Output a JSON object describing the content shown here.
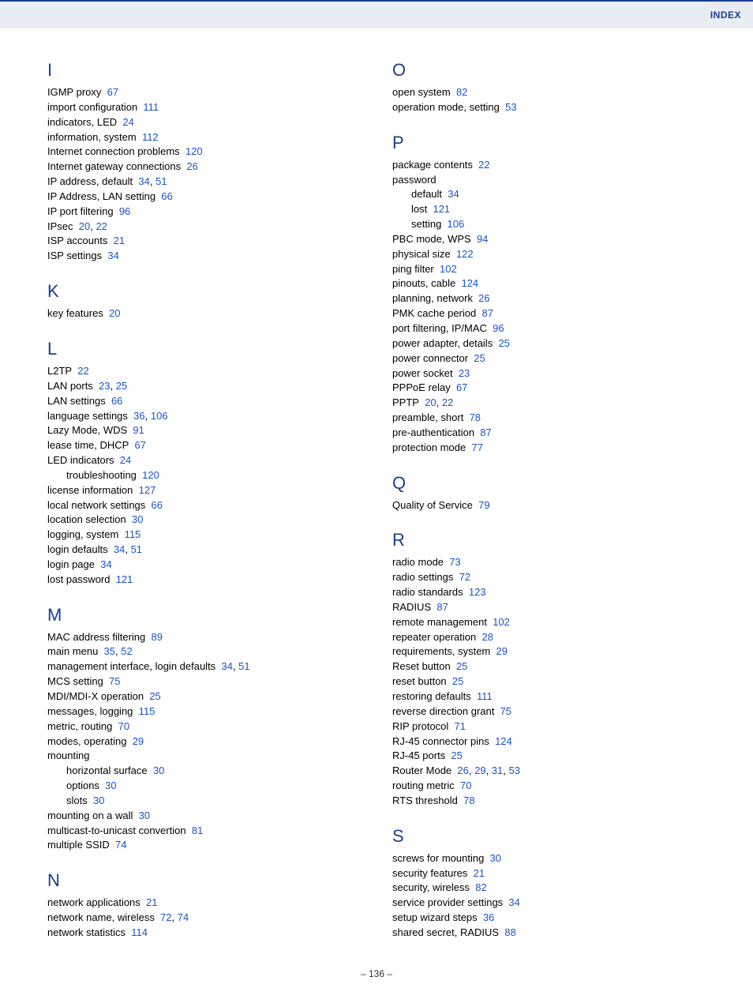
{
  "header": {
    "title": "INDEX"
  },
  "footer": {
    "page_number": "136"
  },
  "columns": [
    {
      "sections": [
        {
          "letter": "I",
          "entries": [
            {
              "label": "IGMP proxy",
              "pages": [
                "67"
              ]
            },
            {
              "label": "import configuration",
              "pages": [
                "111"
              ]
            },
            {
              "label": "indicators, LED",
              "pages": [
                "24"
              ]
            },
            {
              "label": "information, system",
              "pages": [
                "112"
              ]
            },
            {
              "label": "Internet connection problems",
              "pages": [
                "120"
              ]
            },
            {
              "label": "Internet gateway connections",
              "pages": [
                "26"
              ]
            },
            {
              "label": "IP address, default",
              "pages": [
                "34",
                "51"
              ]
            },
            {
              "label": "IP Address, LAN setting",
              "pages": [
                "66"
              ]
            },
            {
              "label": "IP port filtering",
              "pages": [
                "96"
              ]
            },
            {
              "label": "IPsec",
              "pages": [
                "20",
                "22"
              ]
            },
            {
              "label": "ISP accounts",
              "pages": [
                "21"
              ]
            },
            {
              "label": "ISP settings",
              "pages": [
                "34"
              ]
            }
          ]
        },
        {
          "letter": "K",
          "entries": [
            {
              "label": "key features",
              "pages": [
                "20"
              ]
            }
          ]
        },
        {
          "letter": "L",
          "entries": [
            {
              "label": "L2TP",
              "pages": [
                "22"
              ]
            },
            {
              "label": "LAN ports",
              "pages": [
                "23",
                "25"
              ]
            },
            {
              "label": "LAN settings",
              "pages": [
                "66"
              ]
            },
            {
              "label": "language settings",
              "pages": [
                "36",
                "106"
              ]
            },
            {
              "label": "Lazy Mode, WDS",
              "pages": [
                "91"
              ]
            },
            {
              "label": "lease time, DHCP",
              "pages": [
                "67"
              ]
            },
            {
              "label": "LED indicators",
              "pages": [
                "24"
              ]
            },
            {
              "label": "troubleshooting",
              "pages": [
                "120"
              ],
              "sub": true
            },
            {
              "label": "license information",
              "pages": [
                "127"
              ]
            },
            {
              "label": "local network settings",
              "pages": [
                "66"
              ]
            },
            {
              "label": "location selection",
              "pages": [
                "30"
              ]
            },
            {
              "label": "logging, system",
              "pages": [
                "115"
              ]
            },
            {
              "label": "login defaults",
              "pages": [
                "34",
                "51"
              ]
            },
            {
              "label": "login page",
              "pages": [
                "34"
              ]
            },
            {
              "label": "lost password",
              "pages": [
                "121"
              ]
            }
          ]
        },
        {
          "letter": "M",
          "entries": [
            {
              "label": "MAC address filtering",
              "pages": [
                "89"
              ]
            },
            {
              "label": "main menu",
              "pages": [
                "35",
                "52"
              ]
            },
            {
              "label": "management interface, login defaults",
              "pages": [
                "34",
                "51"
              ]
            },
            {
              "label": "MCS setting",
              "pages": [
                "75"
              ]
            },
            {
              "label": "MDI/MDI-X operation",
              "pages": [
                "25"
              ]
            },
            {
              "label": "messages, logging",
              "pages": [
                "115"
              ]
            },
            {
              "label": "metric, routing",
              "pages": [
                "70"
              ]
            },
            {
              "label": "modes, operating",
              "pages": [
                "29"
              ]
            },
            {
              "label": "mounting",
              "pages": []
            },
            {
              "label": "horizontal surface",
              "pages": [
                "30"
              ],
              "sub": true
            },
            {
              "label": "options",
              "pages": [
                "30"
              ],
              "sub": true
            },
            {
              "label": "slots",
              "pages": [
                "30"
              ],
              "sub": true
            },
            {
              "label": "mounting on a wall",
              "pages": [
                "30"
              ]
            },
            {
              "label": "multicast-to-unicast convertion",
              "pages": [
                "81"
              ]
            },
            {
              "label": "multiple SSID",
              "pages": [
                "74"
              ]
            }
          ]
        },
        {
          "letter": "N",
          "entries": [
            {
              "label": "network applications",
              "pages": [
                "21"
              ]
            },
            {
              "label": "network name, wireless",
              "pages": [
                "72",
                "74"
              ]
            },
            {
              "label": "network statistics",
              "pages": [
                "114"
              ]
            }
          ]
        }
      ]
    },
    {
      "sections": [
        {
          "letter": "O",
          "entries": [
            {
              "label": "open system",
              "pages": [
                "82"
              ]
            },
            {
              "label": "operation mode, setting",
              "pages": [
                "53"
              ]
            }
          ]
        },
        {
          "letter": "P",
          "entries": [
            {
              "label": "package contents",
              "pages": [
                "22"
              ]
            },
            {
              "label": "password",
              "pages": []
            },
            {
              "label": "default",
              "pages": [
                "34"
              ],
              "sub": true
            },
            {
              "label": "lost",
              "pages": [
                "121"
              ],
              "sub": true
            },
            {
              "label": "setting",
              "pages": [
                "106"
              ],
              "sub": true
            },
            {
              "label": "PBC mode, WPS",
              "pages": [
                "94"
              ]
            },
            {
              "label": "physical size",
              "pages": [
                "122"
              ]
            },
            {
              "label": "ping filter",
              "pages": [
                "102"
              ]
            },
            {
              "label": "pinouts, cable",
              "pages": [
                "124"
              ]
            },
            {
              "label": "planning, network",
              "pages": [
                "26"
              ]
            },
            {
              "label": "PMK cache period",
              "pages": [
                "87"
              ]
            },
            {
              "label": "port filtering, IP/MAC",
              "pages": [
                "96"
              ]
            },
            {
              "label": "power adapter, details",
              "pages": [
                "25"
              ]
            },
            {
              "label": "power connector",
              "pages": [
                "25"
              ]
            },
            {
              "label": "power socket",
              "pages": [
                "23"
              ]
            },
            {
              "label": "PPPoE relay",
              "pages": [
                "67"
              ]
            },
            {
              "label": "PPTP",
              "pages": [
                "20",
                "22"
              ]
            },
            {
              "label": "preamble, short",
              "pages": [
                "78"
              ]
            },
            {
              "label": "pre-authentication",
              "pages": [
                "87"
              ]
            },
            {
              "label": "protection mode",
              "pages": [
                "77"
              ]
            }
          ]
        },
        {
          "letter": "Q",
          "entries": [
            {
              "label": "Quality of Service",
              "pages": [
                "79"
              ]
            }
          ]
        },
        {
          "letter": "R",
          "entries": [
            {
              "label": "radio mode",
              "pages": [
                "73"
              ]
            },
            {
              "label": "radio settings",
              "pages": [
                "72"
              ]
            },
            {
              "label": "radio standards",
              "pages": [
                "123"
              ]
            },
            {
              "label": "RADIUS",
              "pages": [
                "87"
              ]
            },
            {
              "label": "remote management",
              "pages": [
                "102"
              ]
            },
            {
              "label": "repeater operation",
              "pages": [
                "28"
              ]
            },
            {
              "label": "requirements, system",
              "pages": [
                "29"
              ]
            },
            {
              "label": "Reset button",
              "pages": [
                "25"
              ]
            },
            {
              "label": "reset button",
              "pages": [
                "25"
              ]
            },
            {
              "label": "restoring defaults",
              "pages": [
                "111"
              ]
            },
            {
              "label": "reverse direction grant",
              "pages": [
                "75"
              ]
            },
            {
              "label": "RIP protocol",
              "pages": [
                "71"
              ]
            },
            {
              "label": "RJ-45 connector pins",
              "pages": [
                "124"
              ]
            },
            {
              "label": "RJ-45 ports",
              "pages": [
                "25"
              ]
            },
            {
              "label": "Router Mode",
              "pages": [
                "26",
                "29",
                "31",
                "53"
              ]
            },
            {
              "label": "routing metric",
              "pages": [
                "70"
              ]
            },
            {
              "label": "RTS threshold",
              "pages": [
                "78"
              ]
            }
          ]
        },
        {
          "letter": "S",
          "entries": [
            {
              "label": "screws for mounting",
              "pages": [
                "30"
              ]
            },
            {
              "label": "security features",
              "pages": [
                "21"
              ]
            },
            {
              "label": "security, wireless",
              "pages": [
                "82"
              ]
            },
            {
              "label": "service provider settings",
              "pages": [
                "34"
              ]
            },
            {
              "label": "setup wizard steps",
              "pages": [
                "36"
              ]
            },
            {
              "label": "shared secret, RADIUS",
              "pages": [
                "88"
              ]
            }
          ]
        }
      ]
    }
  ]
}
